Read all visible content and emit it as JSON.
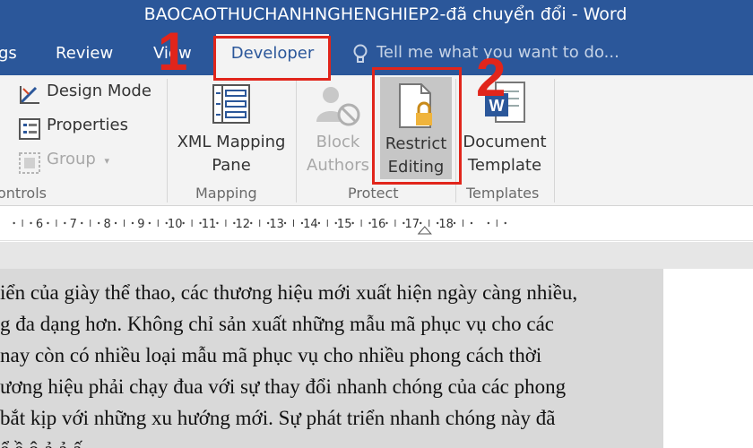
{
  "window": {
    "title": "BAOCAOTHUCHANHNGHENGHIEP2-đã chuyển đổi - Word"
  },
  "tabs": {
    "partial": "gs",
    "review": "Review",
    "view": "View",
    "developer": "Developer",
    "tell_me": "Tell me what you want to do..."
  },
  "ribbon": {
    "controls": {
      "design_mode": "Design Mode",
      "properties": "Properties",
      "group": "Group",
      "label": "ontrols"
    },
    "mapping": {
      "xml_line1": "XML Mapping",
      "xml_line2": "Pane",
      "label": "Mapping"
    },
    "protect": {
      "block_line1": "Block",
      "block_line2": "Authors",
      "restrict_line1": "Restrict",
      "restrict_line2": "Editing",
      "label": "Protect"
    },
    "templates": {
      "doc_line1": "Document",
      "doc_line2": "Template",
      "label": "Templates"
    }
  },
  "annotations": {
    "step1": "1",
    "step2": "2"
  },
  "ruler": {
    "numbers": [
      "6",
      "7",
      "8",
      "9",
      "10",
      "11",
      "12",
      "13",
      "14",
      "15",
      "16",
      "17",
      "18"
    ]
  },
  "document": {
    "lines": [
      "iển của giày thể thao, các thương hiệu mới xuất hiện ngày càng nhiều,",
      "g đa dạng hơn. Không chỉ sản xuất những mẫu mã phục vụ cho các",
      " nay còn có nhiều loại mẫu mã phục vụ cho nhiều phong cách thời",
      "ương hiệu phải chạy đua với sự thay đổi nhanh chóng của các phong",
      "bắt kịp với những xu hướng mới. Sự phát triển  nhanh chóng này đã",
      "ể    ề   ô   ả        ả   ấ   "
    ]
  },
  "colors": {
    "word_blue": "#2b579a",
    "ribbon_bg": "#f3f3f3",
    "annotation_red": "#e1251b",
    "selection_gray": "#d9d9d9"
  },
  "icons": {
    "tell_me": "lightbulb-icon",
    "design_mode": "design-mode-icon",
    "properties": "properties-icon",
    "group": "group-icon",
    "xml_mapping": "xml-mapping-pane-icon",
    "block_authors": "block-authors-icon",
    "restrict_editing": "restrict-editing-lock-icon",
    "document_template": "word-document-template-icon"
  }
}
